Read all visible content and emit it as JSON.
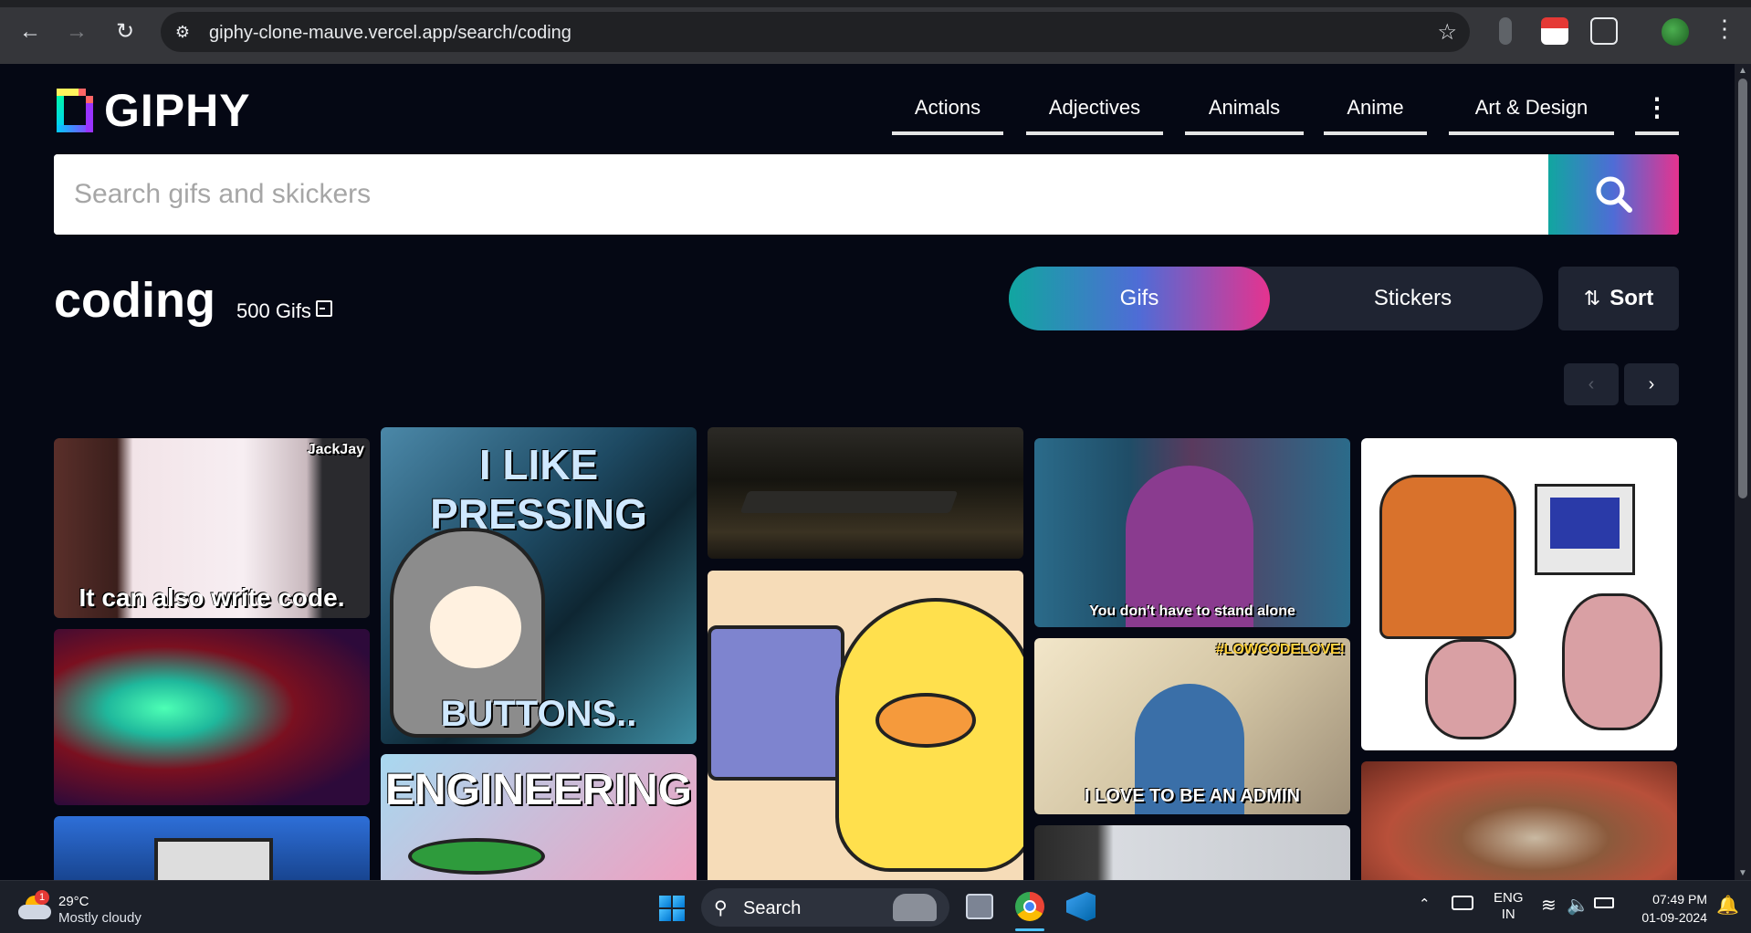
{
  "browser": {
    "url": "giphy-clone-mauve.vercel.app/search/coding"
  },
  "header": {
    "logo_text": "GIPHY",
    "categories": [
      "Actions",
      "Adjectives",
      "Animals",
      "Anime",
      "Art & Design"
    ]
  },
  "search": {
    "placeholder": "Search gifs and skickers",
    "value": ""
  },
  "results": {
    "query": "coding",
    "count_label": "500 Gifs",
    "tabs": {
      "gifs": "Gifs",
      "stickers": "Stickers",
      "active": "Gifs"
    },
    "sort_label": "Sort",
    "gifs": [
      {
        "caption": "It can also write code.",
        "corner": "JackJay"
      },
      {
        "caption": ""
      },
      {
        "caption": ""
      },
      {
        "caption_top": "I LIKE PRESSING",
        "caption": "BUTTONS.."
      },
      {
        "caption_top": "ENGINEERING"
      },
      {
        "caption": ""
      },
      {
        "caption": ""
      },
      {
        "caption": "You don't have to stand alone"
      },
      {
        "caption": "I LOVE TO BE AN ADMIN",
        "corner": "#LOWCODELOVE!"
      },
      {
        "caption": ""
      },
      {
        "caption": ""
      },
      {
        "caption": ""
      }
    ]
  },
  "taskbar": {
    "temperature": "29°C",
    "weather": "Mostly cloudy",
    "weather_badge": "1",
    "search_label": "Search",
    "lang_top": "ENG",
    "lang_bottom": "IN",
    "time": "07:49 PM",
    "date": "01-09-2024"
  },
  "colors": {
    "page_bg": "#050814",
    "accent_gradient_start": "#11a6a0",
    "accent_gradient_end": "#e5338f"
  }
}
